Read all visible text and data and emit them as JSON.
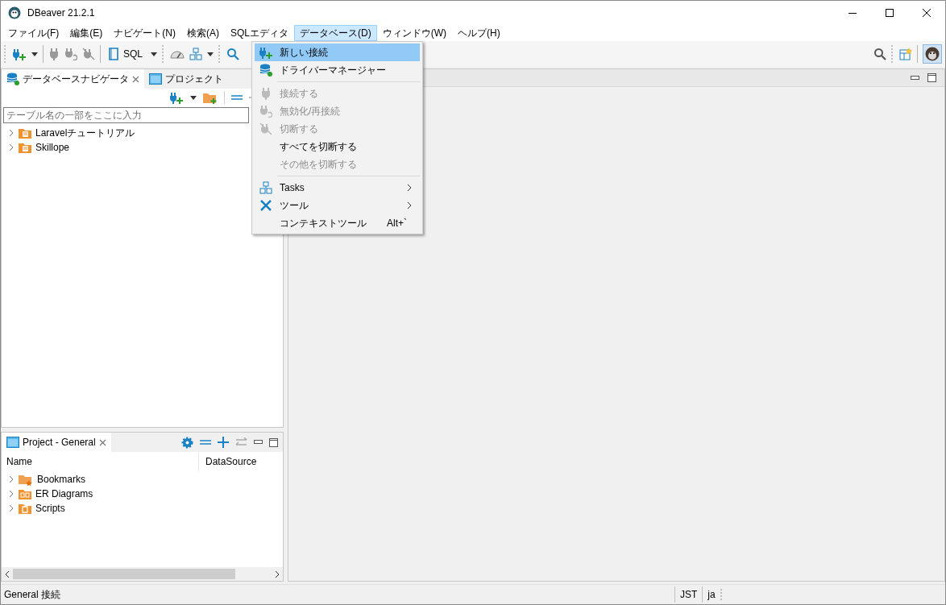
{
  "window": {
    "title": "DBeaver 21.2.1"
  },
  "menubar": [
    {
      "label": "ファイル(F)",
      "selected": false
    },
    {
      "label": "編集(E)",
      "selected": false
    },
    {
      "label": "ナビゲート(N)",
      "selected": false
    },
    {
      "label": "検索(A)",
      "selected": false
    },
    {
      "label": "SQLエディタ",
      "selected": false
    },
    {
      "label": "データベース(D)",
      "selected": true
    },
    {
      "label": "ウィンドウ(W)",
      "selected": false
    },
    {
      "label": "ヘルプ(H)",
      "selected": false
    }
  ],
  "toolbar": {
    "sql_button": "SQL"
  },
  "navigator": {
    "tabs": [
      {
        "label": "データベースナビゲータ",
        "selected": true
      },
      {
        "label": "プロジェクト",
        "selected": false
      }
    ],
    "filter": {
      "placeholder": "テーブル名の一部をここに入力"
    },
    "tree": [
      {
        "label": "Laravelチュートリアル",
        "expanded": false
      },
      {
        "label": "Skillope",
        "expanded": false
      }
    ]
  },
  "project_panel": {
    "tab": {
      "label": "Project - General",
      "selected": true
    },
    "columns": [
      "Name",
      "DataSource"
    ],
    "items": [
      {
        "label": "Bookmarks",
        "kind": "bookmarks",
        "expanded": false
      },
      {
        "label": "ER Diagrams",
        "kind": "diagrams",
        "expanded": false
      },
      {
        "label": "Scripts",
        "kind": "scripts",
        "expanded": false
      }
    ]
  },
  "database_menu": {
    "items": [
      {
        "kind": "item",
        "label": "新しい接続",
        "selected": true,
        "disabled": false
      },
      {
        "kind": "item",
        "label": "ドライバーマネージャー",
        "selected": false,
        "disabled": false
      },
      {
        "kind": "separator"
      },
      {
        "kind": "item",
        "label": "接続する",
        "selected": false,
        "disabled": true
      },
      {
        "kind": "item",
        "label": "無効化/再接続",
        "selected": false,
        "disabled": true
      },
      {
        "kind": "item",
        "label": "切断する",
        "selected": false,
        "disabled": true
      },
      {
        "kind": "item",
        "label": "すべてを切断する",
        "selected": false,
        "disabled": false
      },
      {
        "kind": "item",
        "label": "その他を切断する",
        "selected": false,
        "disabled": true
      },
      {
        "kind": "separator"
      },
      {
        "kind": "submenu",
        "label": "Tasks",
        "selected": false,
        "disabled": false
      },
      {
        "kind": "submenu",
        "label": "ツール",
        "selected": false,
        "disabled": false
      },
      {
        "kind": "item",
        "label": "コンテキストツール",
        "shortcut": "Alt+`",
        "selected": false,
        "disabled": false
      }
    ]
  },
  "status_bar": {
    "message": "General 接続",
    "timezone": "JST",
    "locale": "ja"
  }
}
